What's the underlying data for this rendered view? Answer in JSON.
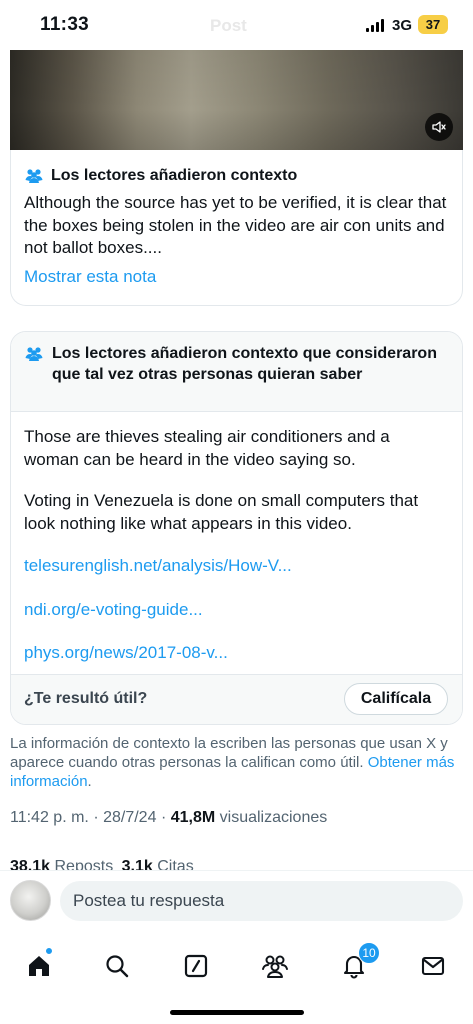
{
  "status_bar": {
    "time": "11:33",
    "network": "3G",
    "battery": "37",
    "faded_header_text": "Post"
  },
  "video": {
    "mute_icon": "speaker-muted-icon"
  },
  "note_1": {
    "icon": "people-icon",
    "title": "Los lectores añadieron contexto",
    "body": "Although the source has yet to be verified, it is clear that the boxes being stolen in the video are air con units and not ballot boxes....",
    "show_note_link": "Mostrar esta nota"
  },
  "note_2": {
    "icon": "people-icon",
    "title": "Los lectores añadieron contexto que consideraron que tal vez otras personas quieran saber",
    "paragraph_1": "Those are thieves stealing air conditioners and a woman can be heard in the video saying so.",
    "paragraph_2": "Voting in Venezuela is done on small computers that look nothing like what appears in this video.",
    "links": [
      "telesurenglish.net/analysis/How-V...",
      "ndi.org/e-voting-guide...",
      "phys.org/news/2017-08-v..."
    ],
    "helpful_question": "¿Te resultó útil?",
    "rate_button": "Califícala"
  },
  "context_info": {
    "text": "La información de contexto la escriben las personas que usan X y aparece cuando otras personas la califican como útil.",
    "link": "Obtener más información",
    "period": "."
  },
  "post_meta": {
    "time": "11:42 p. m.",
    "sep1": "·",
    "date": "28/7/24",
    "sep2": "·",
    "views_count": "41,8M",
    "views_label": "visualizaciones"
  },
  "stats": {
    "reposts_count": "38,1k",
    "reposts_label": "Reposts",
    "quotes_count": "3,1k",
    "quotes_label": "Citas"
  },
  "reply": {
    "placeholder": "Postea tu respuesta"
  },
  "tabbar": {
    "items": [
      "home-icon",
      "search-icon",
      "grok-icon",
      "communities-icon",
      "notifications-icon",
      "messages-icon"
    ],
    "notifications_badge": "10",
    "accent": "#1d9bf0"
  }
}
